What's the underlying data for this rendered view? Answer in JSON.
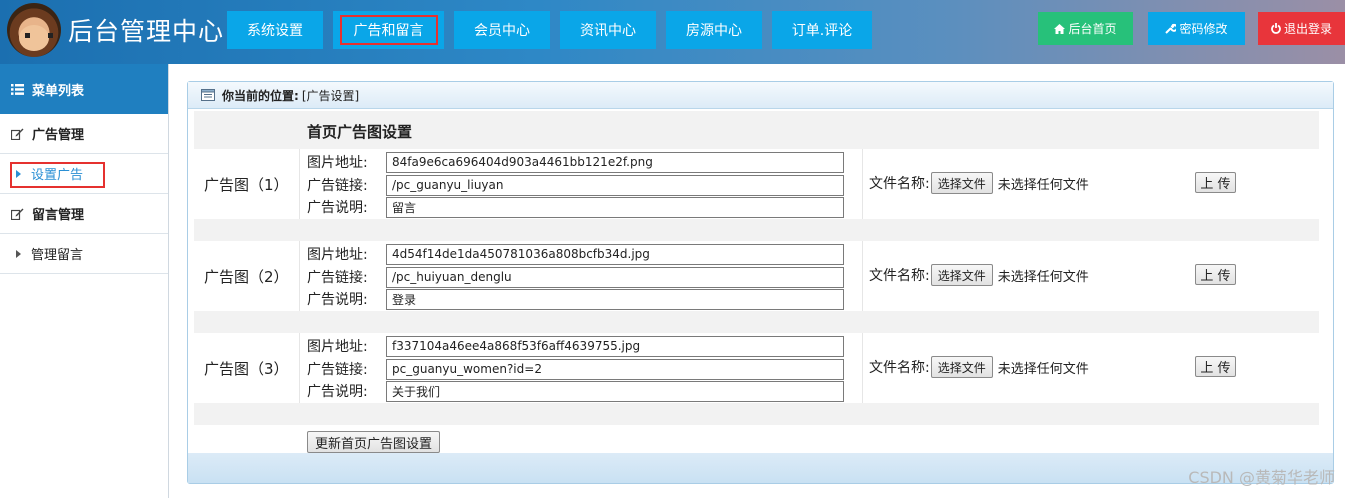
{
  "header": {
    "title": "后台管理中心",
    "nav": [
      "系统设置",
      "广告和留言",
      "会员中心",
      "资讯中心",
      "房源中心",
      "订单.评论"
    ],
    "active_nav": "广告和留言",
    "home_label": "后台首页",
    "password_label": "密码修改",
    "logout_label": "退出登录",
    "colors": {
      "home": "#27c17a",
      "password": "#0aa6e8",
      "logout": "#e8353b"
    }
  },
  "sidebar": {
    "title": "菜单列表",
    "groups": [
      {
        "label": "广告管理",
        "items": [
          "设置广告"
        ]
      },
      {
        "label": "留言管理",
        "items": [
          "管理留言"
        ]
      }
    ],
    "active_item": "设置广告"
  },
  "panel": {
    "location_label": "你当前的位置:",
    "location_value": "[广告设置]",
    "section_title": "首页广告图设置",
    "field_labels": {
      "image": "图片地址:",
      "link": "广告链接:",
      "desc": "广告说明:"
    },
    "file_name_label": "文件名称:",
    "choose_file_label": "选择文件",
    "no_file_label": "未选择任何文件",
    "upload_label": "上 传",
    "ads": [
      {
        "label": "广告图（1）",
        "image": "84fa9e6ca696404d903a4461bb121e2f.png",
        "link": "/pc_guanyu_liuyan",
        "desc": "留言"
      },
      {
        "label": "广告图（2）",
        "image": "4d54f14de1da450781036a808bcfb34d.jpg",
        "link": "/pc_huiyuan_denglu",
        "desc": "登录"
      },
      {
        "label": "广告图（3）",
        "image": "f337104a46ee4a868f53f6aff4639755.jpg",
        "link": "pc_guanyu_women?id=2",
        "desc": "关于我们"
      }
    ],
    "submit_label": "更新首页广告图设置"
  },
  "watermark": "CSDN @黄菊华老师"
}
